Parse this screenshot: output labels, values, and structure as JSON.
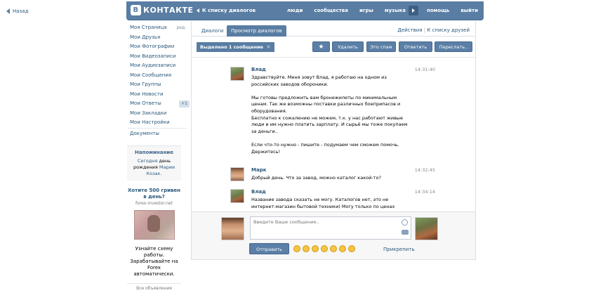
{
  "back_link": "Назад",
  "header": {
    "logo_letter": "В",
    "logo_text": "КОНТАКТЕ",
    "back_to_dialogs": "К списку диалогов",
    "nav": [
      "люди",
      "сообщества",
      "игры",
      "музыка",
      "помощь",
      "выйти"
    ]
  },
  "sidebar": {
    "items": [
      {
        "label": "Моя Страница",
        "extra": "ред."
      },
      {
        "label": "Мои Друзья"
      },
      {
        "label": "Мои Фотографии"
      },
      {
        "label": "Мои Видеозаписи"
      },
      {
        "label": "Мои Аудиозаписи"
      },
      {
        "label": "Мои Сообщения"
      },
      {
        "label": "Мои Группы"
      },
      {
        "label": "Мои Новости"
      },
      {
        "label": "Мои Ответы",
        "badge": "+1"
      },
      {
        "label": "Мои Закладки"
      },
      {
        "label": "Мои Настройки"
      }
    ],
    "docs": "Документы"
  },
  "reminder": {
    "title": "Напоминание",
    "line1_a": "Сегодня",
    "line1_b": "день",
    "line2_a": "рождения",
    "line2_b": "Марии",
    "line3": "Козак."
  },
  "ad": {
    "title": "Хотите 500 гривен в день?",
    "domain": "forex-investor.net",
    "body": "Узнайте схему работы. Зарабатывайте на Forex автоматически.",
    "all_ads": "Все объявления"
  },
  "tabs": {
    "dialogs": "Диалоги",
    "view": "Просмотр диалогов",
    "actions": "Действия",
    "sep": "|",
    "to_friends": "К списку друзей"
  },
  "actions": {
    "selected": "Выделено 1 сообщение",
    "selected_close": "×",
    "star": "★",
    "delete": "Удалить",
    "spam": "Это спам",
    "reply": "Ответить",
    "forward": "Переслать.."
  },
  "messages": [
    {
      "name": "Влад",
      "time": "14:31:40",
      "text": "Здравствуйте. Меня зовут Влад, я работаю на одном из российских заводов обороники.\n\nМы готовы предложить вам бронежилеты по минимальным ценам. Так же возможны поставки различных боеприпасов и оборудования.\nБесплатно к сожалению не можем, т.к. у нас работают живые люди и им нужно платить зарплату. И сырьё мы тоже покупаем за деньги..\n\nЕсли что-то нужно - пишите - подумаем чем сможем помочь. Держитесь!"
    },
    {
      "name": "Марк",
      "time": "14:32:45",
      "text": "Добрый день. Что за завод, можно каталог какой-то?"
    },
    {
      "name": "Влад",
      "time": "14:34:14",
      "text": "Название завода сказать не могу. Каталогов нет, это не интернет-магазин бытовой техники) Могу только по ценах сказать"
    }
  ],
  "compose": {
    "placeholder": "Введите Ваше сообщение..",
    "send": "Отправить",
    "attach": "Прикрепить",
    "emojis": [
      "😏",
      "😊",
      "😘",
      "😮",
      "😝",
      "😛",
      "😄"
    ]
  }
}
